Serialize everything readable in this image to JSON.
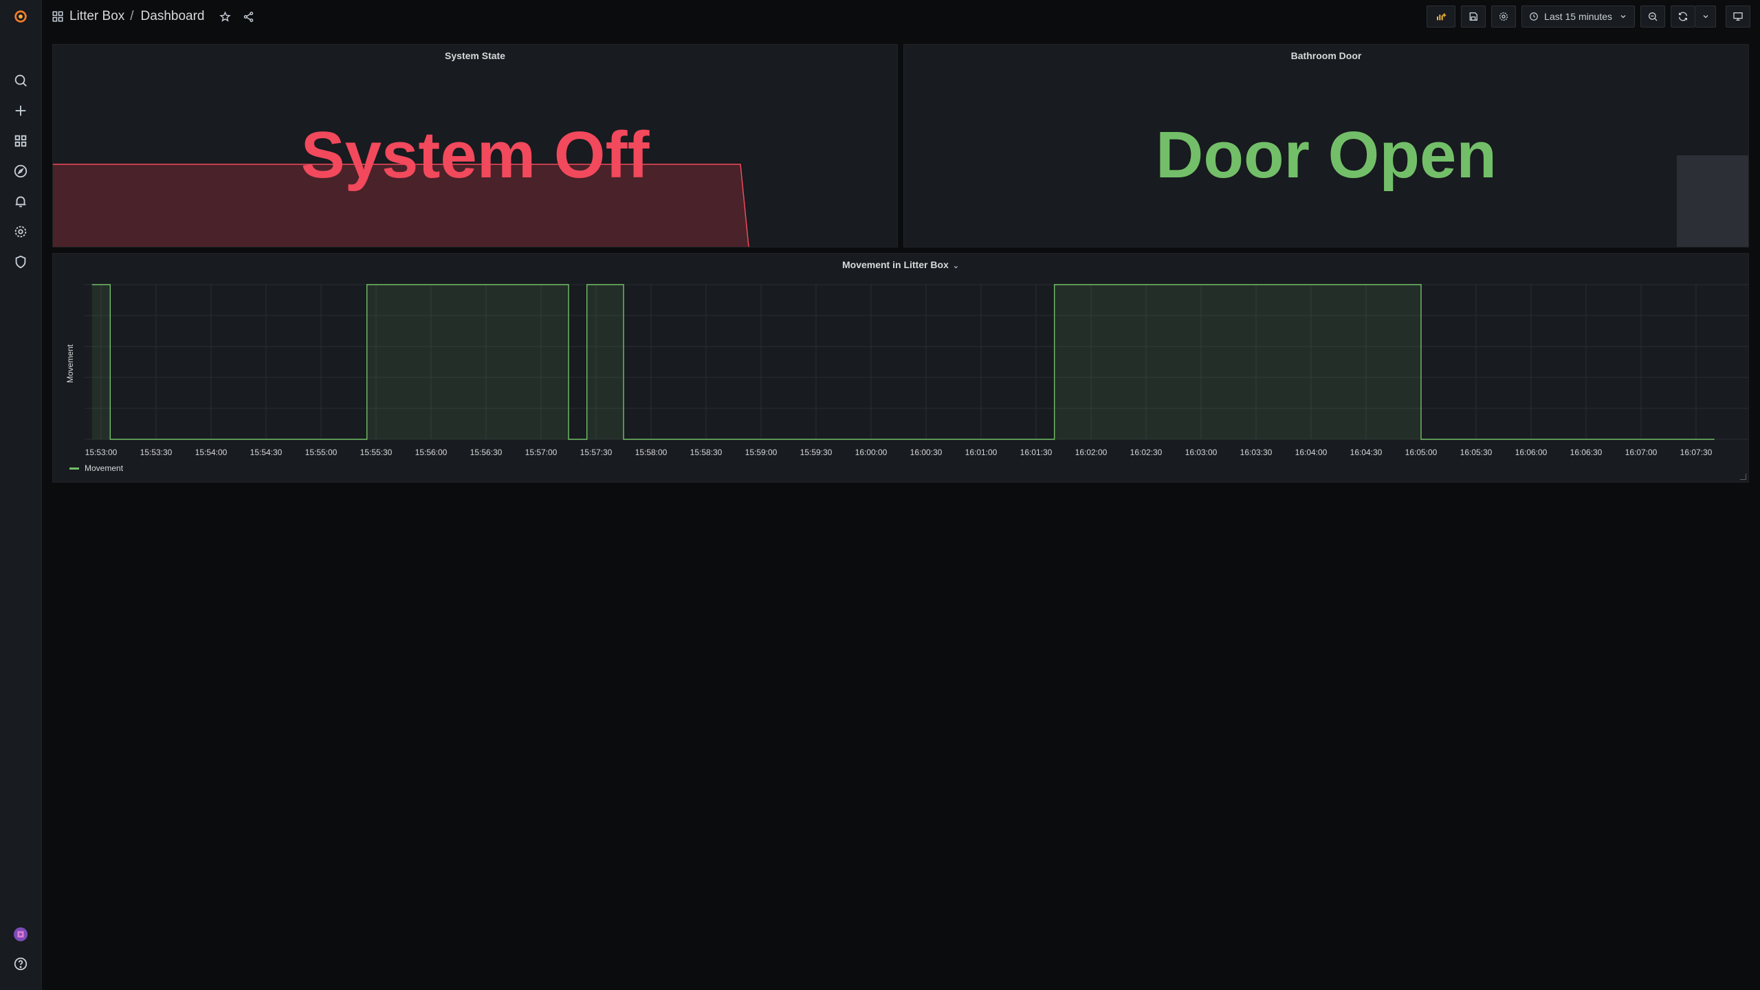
{
  "app": {
    "logo": "grafana-logo-icon"
  },
  "sidebar": {
    "items": [
      {
        "name": "search-icon"
      },
      {
        "name": "plus-icon"
      },
      {
        "name": "dashboards-icon"
      },
      {
        "name": "explore-compass-icon"
      },
      {
        "name": "alert-bell-icon"
      },
      {
        "name": "gear-icon"
      },
      {
        "name": "shield-icon"
      }
    ],
    "bottom": [
      {
        "name": "avatar"
      },
      {
        "name": "help-icon"
      }
    ]
  },
  "breadcrumb": {
    "folder": "Litter Box",
    "separator": "/",
    "dashboard": "Dashboard"
  },
  "toolbar": {
    "time_range": "Last 15 minutes"
  },
  "panels": {
    "system_state": {
      "title": "System State",
      "value": "System Off",
      "color": "#f2495c"
    },
    "bathroom_door": {
      "title": "Bathroom Door",
      "value": "Door Open",
      "color": "#73bf69"
    },
    "movement": {
      "title": "Movement in Litter Box",
      "ylabel": "Movement",
      "legend": "Movement",
      "color": "#73bf69"
    }
  },
  "chart_data": {
    "type": "line",
    "title": "Movement in Litter Box",
    "xlabel": "",
    "ylabel": "Movement",
    "x_ticks": [
      "15:53:00",
      "15:53:30",
      "15:54:00",
      "15:54:30",
      "15:55:00",
      "15:55:30",
      "15:56:00",
      "15:56:30",
      "15:57:00",
      "15:57:30",
      "15:58:00",
      "15:58:30",
      "15:59:00",
      "15:59:30",
      "16:00:00",
      "16:00:30",
      "16:01:00",
      "16:01:30",
      "16:02:00",
      "16:02:30",
      "16:03:00",
      "16:03:30",
      "16:04:00",
      "16:04:30",
      "16:05:00",
      "16:05:30",
      "16:06:00",
      "16:06:30",
      "16:07:00",
      "16:07:30"
    ],
    "ylim": [
      0,
      1
    ],
    "grid": true,
    "legend_position": "bottom-left",
    "series": [
      {
        "name": "Movement",
        "step": true,
        "points": [
          [
            "15:52:55",
            1
          ],
          [
            "15:53:05",
            0
          ],
          [
            "15:55:25",
            1
          ],
          [
            "15:57:15",
            0
          ],
          [
            "15:57:25",
            1
          ],
          [
            "15:57:45",
            0
          ],
          [
            "16:01:40",
            1
          ],
          [
            "16:05:00",
            0
          ],
          [
            "16:07:40",
            0
          ]
        ]
      }
    ]
  }
}
